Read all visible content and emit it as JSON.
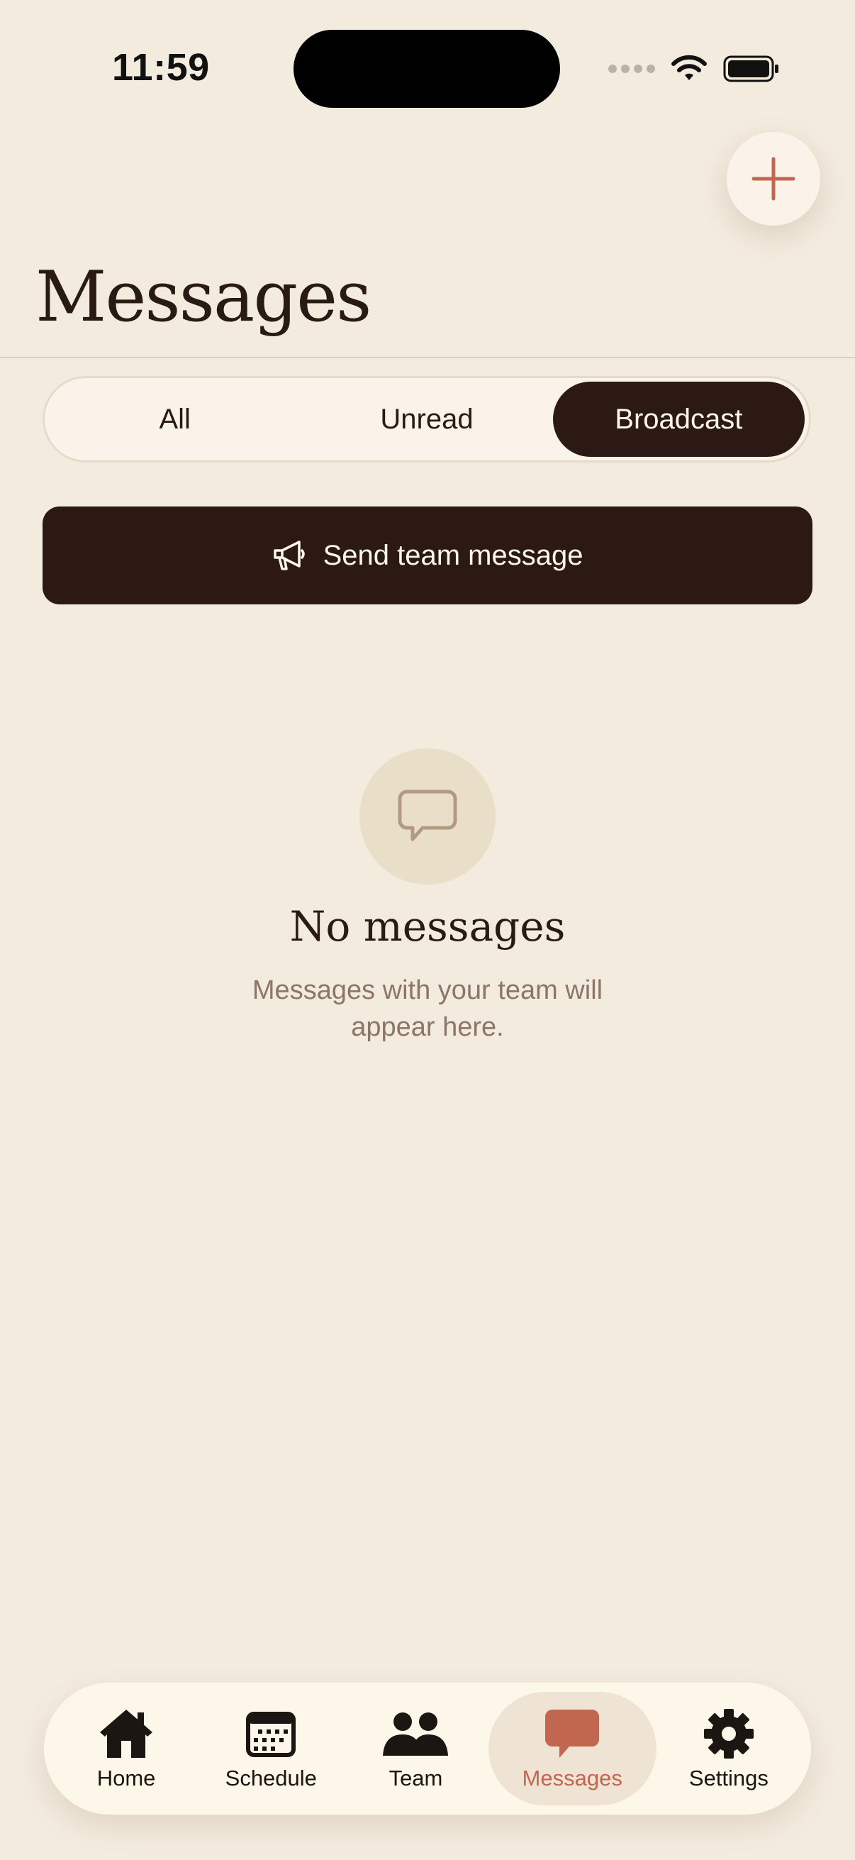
{
  "status_bar": {
    "time": "11:59"
  },
  "header": {
    "title": "Messages"
  },
  "filter": {
    "options": [
      "All",
      "Unread",
      "Broadcast"
    ],
    "selected": "Broadcast"
  },
  "send_button": {
    "label": "Send team message",
    "icon": "megaphone-icon"
  },
  "empty_state": {
    "icon": "chat-bubble-icon",
    "title": "No messages",
    "subtitle": "Messages with your team will appear here."
  },
  "tabbar": {
    "items": [
      {
        "label": "Home",
        "icon": "home-icon"
      },
      {
        "label": "Schedule",
        "icon": "calendar-icon"
      },
      {
        "label": "Team",
        "icon": "team-icon"
      },
      {
        "label": "Messages",
        "icon": "chat-bubble-icon"
      },
      {
        "label": "Settings",
        "icon": "gear-icon"
      }
    ],
    "active": "Messages"
  },
  "colors": {
    "background": "#F3EBDE",
    "dark": "#2C1913",
    "accent": "#C2674F",
    "muted_text": "#8C7668"
  }
}
